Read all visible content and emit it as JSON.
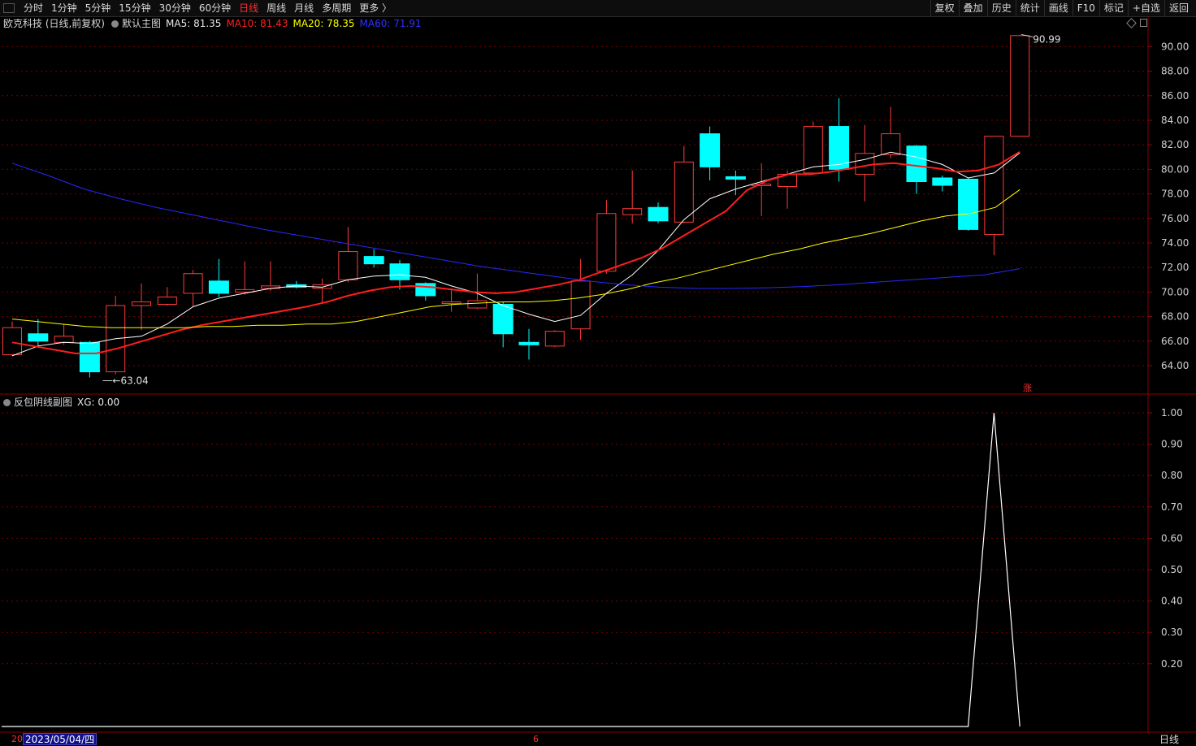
{
  "toolbar": {
    "period_tabs": [
      "分时",
      "1分钟",
      "5分钟",
      "15分钟",
      "30分钟",
      "60分钟",
      "日线",
      "周线",
      "月线",
      "多周期",
      "更多 〉"
    ],
    "active_period": "日线",
    "tools": [
      "复权",
      "叠加",
      "历史",
      "统计",
      "画线",
      "F10",
      "标记",
      "+自选",
      "返回"
    ]
  },
  "main_legend": {
    "stock": "欧克科技 (日线,前复权)",
    "template": "默认主图",
    "ma5": "MA5: 81.35",
    "ma10": "MA10: 81.43",
    "ma20": "MA20: 78.35",
    "ma60": "MA60: 71.91"
  },
  "sub_legend": {
    "title": "反包阴线副图",
    "xg": "XG: 0.00"
  },
  "annotations": {
    "high": "90.99",
    "low": "63.04",
    "rise_marker": "涨"
  },
  "bottom_bar": {
    "tick_start": "20",
    "selected_date": "2023/05/04/四",
    "tick_month": "6",
    "period_label": "日线"
  },
  "colors": {
    "up": "#ff3b3b",
    "down": "#00ffff",
    "ma5": "#ffffff",
    "ma10": "#ff1e1e",
    "ma20": "#ffff00",
    "ma60": "#2828ff",
    "grid": "#7a0000",
    "axis": "#c0c0c0"
  },
  "chart_data": [
    {
      "type": "candlestick",
      "title": "欧克科技 (日线,前复权)",
      "ylim": [
        63,
        91
      ],
      "yticks": [
        64,
        66,
        68,
        70,
        72,
        74,
        76,
        78,
        80,
        82,
        84,
        86,
        88,
        90
      ],
      "candles": [
        {
          "o": 64.9,
          "c": 67.1,
          "h": 67.6,
          "l": 64.8
        },
        {
          "o": 66.6,
          "c": 66.0,
          "h": 67.8,
          "l": 65.5
        },
        {
          "o": 65.9,
          "c": 66.4,
          "h": 67.4,
          "l": 65.7
        },
        {
          "o": 65.9,
          "c": 63.5,
          "h": 66.0,
          "l": 63.04
        },
        {
          "o": 63.5,
          "c": 68.9,
          "h": 69.7,
          "l": 63.3
        },
        {
          "o": 68.9,
          "c": 69.2,
          "h": 70.7,
          "l": 66.9
        },
        {
          "o": 69.0,
          "c": 69.6,
          "h": 70.4,
          "l": 68.9
        },
        {
          "o": 69.9,
          "c": 71.5,
          "h": 71.8,
          "l": 68.8
        },
        {
          "o": 70.9,
          "c": 69.9,
          "h": 72.7,
          "l": 69.6
        },
        {
          "o": 70.0,
          "c": 70.2,
          "h": 72.5,
          "l": 69.8
        },
        {
          "o": 70.3,
          "c": 70.5,
          "h": 72.5,
          "l": 70.1
        },
        {
          "o": 70.6,
          "c": 70.4,
          "h": 70.9,
          "l": 70.3
        },
        {
          "o": 70.3,
          "c": 70.6,
          "h": 71.1,
          "l": 69.1
        },
        {
          "o": 71.0,
          "c": 73.3,
          "h": 75.3,
          "l": 70.8
        },
        {
          "o": 72.9,
          "c": 72.3,
          "h": 73.5,
          "l": 72.0
        },
        {
          "o": 72.3,
          "c": 71.0,
          "h": 72.6,
          "l": 70.2
        },
        {
          "o": 70.7,
          "c": 69.7,
          "h": 70.8,
          "l": 69.3
        },
        {
          "o": 69.2,
          "c": 69.2,
          "h": 70.3,
          "l": 68.4
        },
        {
          "o": 68.7,
          "c": 69.3,
          "h": 71.5,
          "l": 68.6
        },
        {
          "o": 69.0,
          "c": 66.6,
          "h": 69.2,
          "l": 65.5
        },
        {
          "o": 65.9,
          "c": 65.7,
          "h": 67.0,
          "l": 64.5
        },
        {
          "o": 65.6,
          "c": 66.8,
          "h": 66.9,
          "l": 65.5
        },
        {
          "o": 67.0,
          "c": 70.9,
          "h": 72.7,
          "l": 66.1
        },
        {
          "o": 71.7,
          "c": 76.4,
          "h": 77.5,
          "l": 71.5
        },
        {
          "o": 76.3,
          "c": 76.8,
          "h": 79.9,
          "l": 75.6
        },
        {
          "o": 76.9,
          "c": 75.8,
          "h": 77.3,
          "l": 75.6
        },
        {
          "o": 75.7,
          "c": 80.6,
          "h": 81.9,
          "l": 75.6
        },
        {
          "o": 82.9,
          "c": 80.2,
          "h": 83.5,
          "l": 79.1
        },
        {
          "o": 79.4,
          "c": 79.2,
          "h": 79.9,
          "l": 77.9
        },
        {
          "o": 78.7,
          "c": 78.8,
          "h": 80.5,
          "l": 76.2
        },
        {
          "o": 78.6,
          "c": 79.6,
          "h": 79.9,
          "l": 76.8
        },
        {
          "o": 79.7,
          "c": 83.5,
          "h": 83.9,
          "l": 79.6
        },
        {
          "o": 83.5,
          "c": 80.0,
          "h": 85.8,
          "l": 79.0
        },
        {
          "o": 79.6,
          "c": 81.3,
          "h": 83.6,
          "l": 77.4
        },
        {
          "o": 81.2,
          "c": 82.9,
          "h": 85.1,
          "l": 80.9
        },
        {
          "o": 81.9,
          "c": 79.0,
          "h": 82.0,
          "l": 78.0
        },
        {
          "o": 79.3,
          "c": 78.7,
          "h": 79.5,
          "l": 78.2
        },
        {
          "o": 79.2,
          "c": 75.1,
          "h": 79.3,
          "l": 75.0
        },
        {
          "o": 74.7,
          "c": 82.7,
          "h": 82.7,
          "l": 73.0
        },
        {
          "o": 82.7,
          "c": 90.9,
          "h": 90.99,
          "l": 82.7
        }
      ],
      "series": [
        {
          "name": "MA5",
          "values": [
            64.8,
            65.6,
            65.9,
            65.8,
            66.2,
            66.4,
            67.4,
            68.8,
            69.5,
            69.9,
            70.3,
            70.5,
            70.4,
            71.0,
            71.3,
            71.4,
            71.2,
            70.5,
            69.9,
            68.9,
            68.2,
            67.6,
            68.1,
            69.9,
            71.4,
            73.4,
            75.9,
            77.6,
            78.4,
            79.0,
            79.6,
            80.2,
            80.4,
            80.8,
            81.4,
            81.0,
            80.4,
            79.3,
            79.7,
            81.35
          ]
        },
        {
          "name": "MA10",
          "values": [
            65.9,
            65.6,
            65.3,
            65.0,
            65.0,
            65.4,
            65.9,
            66.4,
            66.9,
            67.3,
            67.6,
            67.9,
            68.2,
            68.5,
            68.8,
            69.2,
            69.7,
            70.1,
            70.4,
            70.5,
            70.4,
            70.2,
            70.0,
            69.9,
            70.0,
            70.3,
            70.6,
            71.0,
            71.6,
            72.2,
            72.8,
            73.6,
            74.6,
            75.6,
            76.6,
            78.3,
            79.1,
            79.6,
            79.6,
            79.8,
            80.1,
            80.4,
            80.5,
            80.3,
            80.1,
            79.8,
            79.9,
            80.4,
            81.43
          ]
        },
        {
          "name": "MA20",
          "values": [
            67.8,
            67.6,
            67.4,
            67.2,
            67.1,
            67.1,
            67.1,
            67.1,
            67.2,
            67.2,
            67.3,
            67.3,
            67.4,
            67.4,
            67.6,
            68.0,
            68.4,
            68.8,
            69.0,
            69.1,
            69.2,
            69.2,
            69.3,
            69.5,
            69.8,
            70.2,
            70.7,
            71.1,
            71.6,
            72.1,
            72.6,
            73.1,
            73.5,
            74.0,
            74.4,
            74.8,
            75.3,
            75.8,
            76.2,
            76.4,
            76.9,
            78.35
          ]
        },
        {
          "name": "MA60",
          "values": [
            80.5,
            79.5,
            78.4,
            77.6,
            76.9,
            76.3,
            75.7,
            75.1,
            74.6,
            74.1,
            73.6,
            73.1,
            72.6,
            72.1,
            71.7,
            71.3,
            70.9,
            70.6,
            70.4,
            70.3,
            70.3,
            70.35,
            70.45,
            70.6,
            70.8,
            71.0,
            71.2,
            71.4,
            71.91
          ]
        }
      ],
      "high_label": "90.99",
      "low_label": "63.04"
    },
    {
      "type": "line",
      "title": "反包阴线副图",
      "ylim": [
        0,
        1.05
      ],
      "yticks": [
        0.2,
        0.3,
        0.4,
        0.5,
        0.6,
        0.7,
        0.8,
        0.9,
        1.0
      ],
      "series": [
        {
          "name": "XG",
          "values": [
            0,
            0,
            0,
            0,
            0,
            0,
            0,
            0,
            0,
            0,
            0,
            0,
            0,
            0,
            0,
            0,
            0,
            0,
            0,
            0,
            0,
            0,
            0,
            0,
            0,
            0,
            0,
            0,
            0,
            0,
            0,
            0,
            0,
            0,
            0,
            0,
            0,
            0,
            1,
            0
          ]
        }
      ]
    }
  ]
}
